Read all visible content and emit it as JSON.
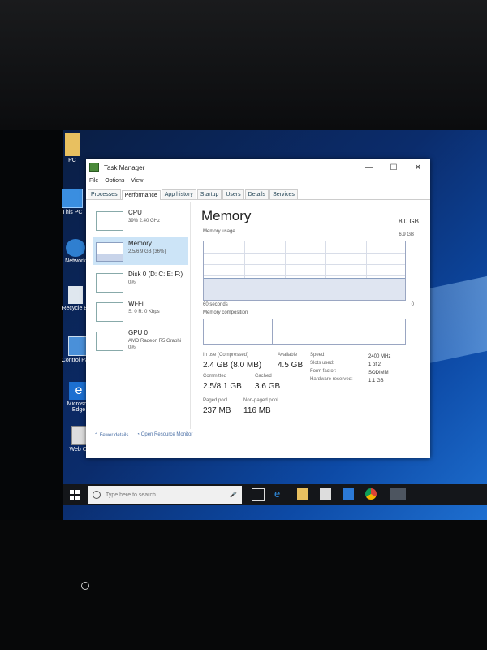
{
  "desktop": {
    "icons": [
      {
        "label": "PC",
        "icon": "folder-icon"
      },
      {
        "label": "This PC",
        "icon": "monitor-icon"
      },
      {
        "label": "Network",
        "icon": "network-icon"
      },
      {
        "label": "Recycle Bi",
        "icon": "recycle-bin-icon"
      },
      {
        "label": "Control Panel",
        "icon": "control-panel-icon"
      },
      {
        "label": "Microsoft Edge",
        "icon": "edge-icon"
      },
      {
        "label": "Web Cam",
        "icon": "webcam-icon"
      }
    ]
  },
  "window": {
    "title": "Task Manager",
    "controls": {
      "minimize": "—",
      "maximize": "☐",
      "close": "✕"
    },
    "menu": [
      "File",
      "Options",
      "View"
    ],
    "tabs": [
      "Processes",
      "Performance",
      "App history",
      "Startup",
      "Users",
      "Details",
      "Services"
    ],
    "active_tab": "Performance"
  },
  "resources": [
    {
      "name": "CPU",
      "sub": "39% 2.40 GHz",
      "sub2": ""
    },
    {
      "name": "Memory",
      "sub": "2.5/6.9 GB (36%)",
      "sub2": ""
    },
    {
      "name": "Disk 0 (D: C: E: F:)",
      "sub": "0%",
      "sub2": ""
    },
    {
      "name": "Wi-Fi",
      "sub": "S: 0 R: 0 Kbps",
      "sub2": ""
    },
    {
      "name": "GPU 0",
      "sub": "AMD Radeon R5 Graphi",
      "sub2": "0%"
    }
  ],
  "memory": {
    "heading": "Memory",
    "total": "8.0 GB",
    "usage_label": "Memory usage",
    "max_label": "6.9 GB",
    "time_label": "60 seconds",
    "min_label": "0",
    "composition_label": "Memory composition",
    "in_use_label": "In use (Compressed)",
    "in_use_value": "2.4 GB (8.0 MB)",
    "available_label": "Available",
    "available_value": "4.5 GB",
    "committed_label": "Committed",
    "committed_value": "2.5/8.1 GB",
    "cached_label": "Cached",
    "cached_value": "3.6 GB",
    "paged_label": "Paged pool",
    "paged_value": "237 MB",
    "nonpaged_label": "Non-paged pool",
    "nonpaged_value": "116 MB",
    "speed_label": "Speed:",
    "speed_value": "2400 MHz",
    "slots_label": "Slots used:",
    "slots_value": "1 of 2",
    "form_label": "Form factor:",
    "form_value": "SODIMM",
    "hw_label": "Hardware reserved:",
    "hw_value": "1.1 GB"
  },
  "footer": {
    "fewer": "Fewer details",
    "monitor": "Open Resource Monitor"
  },
  "taskbar": {
    "search_placeholder": "Type here to search"
  },
  "colors": {
    "selection": "#cce4f7",
    "graph_border": "#8b9fc0",
    "desktop": "#0b2c6c"
  }
}
